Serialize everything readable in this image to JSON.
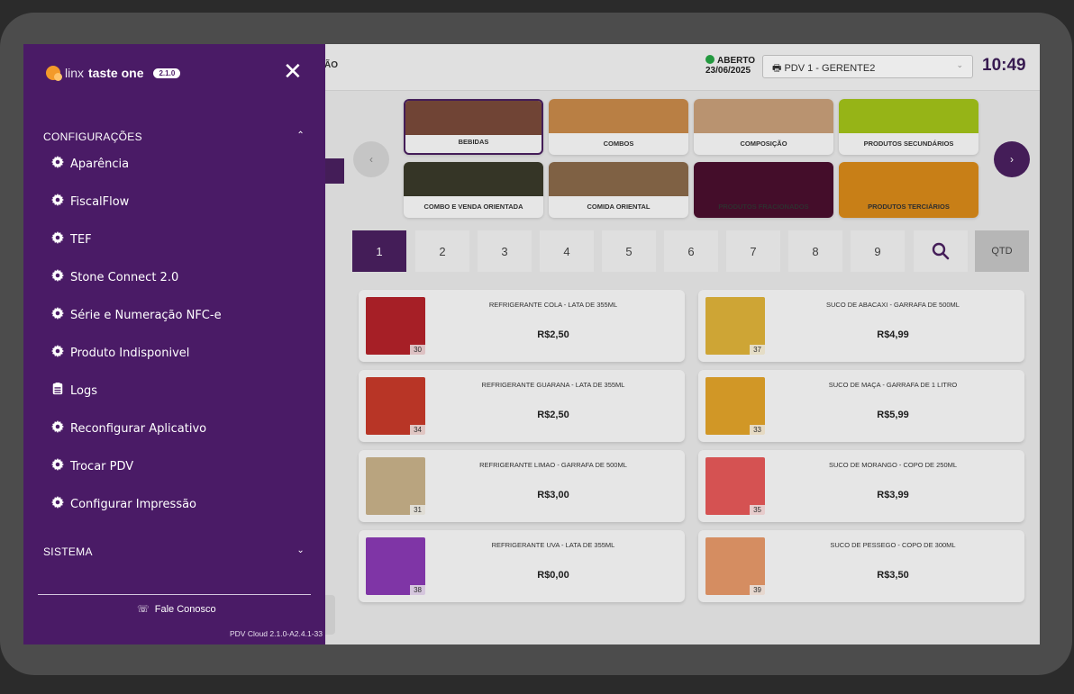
{
  "app": {
    "hidden_title_fragment": "ÃO",
    "status_label": "ABERTO",
    "status_date": "23/06/2025",
    "status_color": "#27a745",
    "pdv_selected": "PDV 1 - GERENTE2",
    "clock": "10:49"
  },
  "categories": [
    {
      "label": "BEBIDAS",
      "color": "#7a4a3a",
      "selected": true
    },
    {
      "label": "COMBOS",
      "color": "#c98a4a"
    },
    {
      "label": "COMPOSIÇÃO",
      "color": "#c9a07a"
    },
    {
      "label": "PRODUTOS SECUNDÁRIOS",
      "color": "#a3c41a"
    },
    {
      "label": "COMBO E VENDA ORIENTADA",
      "color": "#3a3a2a"
    },
    {
      "label": "COMIDA ORIENTAL",
      "color": "#8a6a4a"
    },
    {
      "label": "PRODUTOS FRACIONADOS",
      "color": "#4a0f2e"
    },
    {
      "label": "PRODUTOS TERCIÁRIOS",
      "color": "#d98a1a"
    }
  ],
  "pages": [
    "1",
    "2",
    "3",
    "4",
    "5",
    "6",
    "7",
    "8",
    "9"
  ],
  "qtd_label": "QTD",
  "products": [
    {
      "name": "REFRIGERANTE COLA - LATA DE 355ML",
      "price": "R$2,50",
      "num": "30",
      "color": "#b5222a"
    },
    {
      "name": "SUCO DE ABACAXI - GARRAFA DE 500ML",
      "price": "R$4,99",
      "num": "37",
      "color": "#e0b33a"
    },
    {
      "name": "REFRIGERANTE GUARANA - LATA DE 355ML",
      "price": "R$2,50",
      "num": "34",
      "color": "#c83a2a"
    },
    {
      "name": "SUCO DE MAÇA - GARRAFA DE 1 LITRO",
      "price": "R$5,99",
      "num": "33",
      "color": "#e3a42a"
    },
    {
      "name": "REFRIGERANTE LIMAO - GARRAFA DE 500ML",
      "price": "R$3,00",
      "num": "31",
      "color": "#c9b28a"
    },
    {
      "name": "SUCO DE MORANGO - COPO DE 250ML",
      "price": "R$3,99",
      "num": "35",
      "color": "#e85a5a"
    },
    {
      "name": "REFRIGERANTE UVA - LATA DE 355ML",
      "price": "R$0,00",
      "num": "38",
      "color": "#8a3ab5"
    },
    {
      "name": "SUCO DE PESSEGO - COPO DE 300ML",
      "price": "R$3,50",
      "num": "39",
      "color": "#e89a6a"
    }
  ],
  "drawer": {
    "brand_prefix": "linx",
    "brand_name": "taste one",
    "version": "2.1.0",
    "sections": {
      "config": "CONFIGURAÇÕES",
      "system": "SISTEMA"
    },
    "items": [
      {
        "label": "Aparência",
        "icon": "gear-icon"
      },
      {
        "label": "FiscalFlow",
        "icon": "gear-icon"
      },
      {
        "label": "TEF",
        "icon": "gear-icon"
      },
      {
        "label": "Stone Connect 2.0",
        "icon": "gear-icon"
      },
      {
        "label": "Série e Numeração NFC-e",
        "icon": "gear-icon"
      },
      {
        "label": "Produto Indisponivel",
        "icon": "gear-icon"
      },
      {
        "label": "Logs",
        "icon": "list-icon"
      },
      {
        "label": "Reconfigurar Aplicativo",
        "icon": "gear-icon"
      },
      {
        "label": "Trocar PDV",
        "icon": "gear-icon"
      },
      {
        "label": "Configurar Impressão",
        "icon": "gear-icon"
      }
    ],
    "contact": "Fale Conosco",
    "build": "PDV Cloud 2.1.0-A2.4.1-33"
  }
}
